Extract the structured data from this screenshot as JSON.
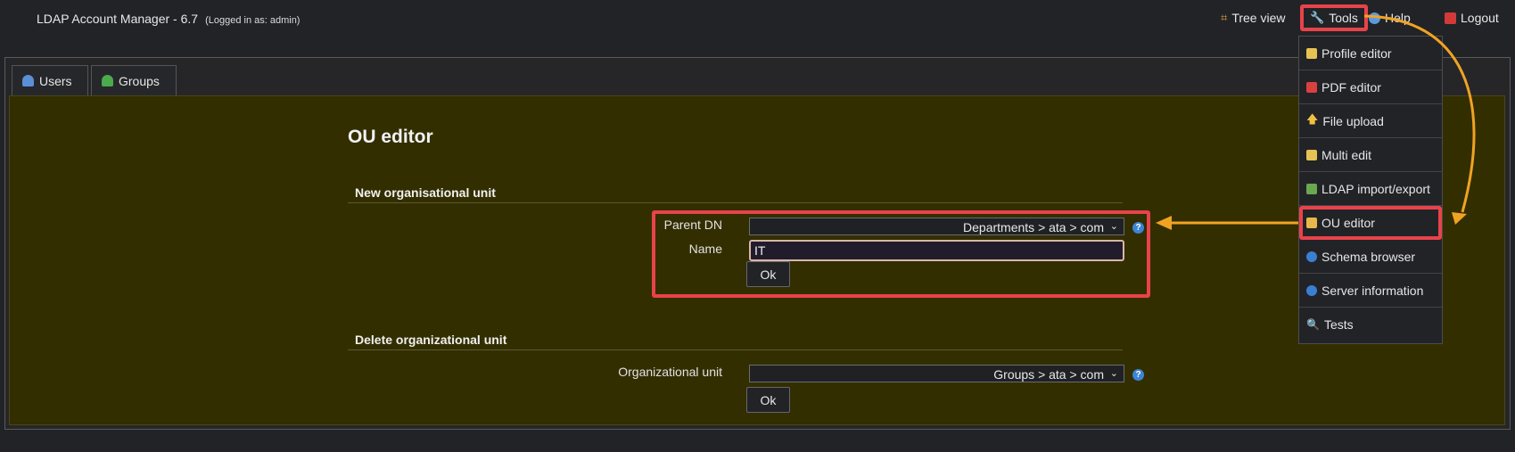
{
  "header": {
    "app_title": "LDAP Account Manager - 6.7",
    "logged_in": "(Logged in as: admin)",
    "links": {
      "tree_view": "Tree view",
      "tools": "Tools",
      "help": "Help",
      "logout": "Logout"
    }
  },
  "tabs": [
    {
      "label": "Users"
    },
    {
      "label": "Groups"
    }
  ],
  "page": {
    "title": "OU editor",
    "new_section": {
      "heading": "New organisational unit",
      "parent_dn_label": "Parent DN",
      "parent_dn_value": "Departments > ata > com",
      "name_label": "Name",
      "name_value": "IT",
      "ok_label": "Ok"
    },
    "delete_section": {
      "heading": "Delete organizational unit",
      "ou_label": "Organizational unit",
      "ou_value": "Groups > ata > com",
      "ok_label": "Ok"
    }
  },
  "tools_menu": {
    "items": [
      {
        "label": "Profile editor",
        "icon": "profile-edit-icon"
      },
      {
        "label": "PDF editor",
        "icon": "pdf-icon"
      },
      {
        "label": "File upload",
        "icon": "upload-arrow-icon"
      },
      {
        "label": "Multi edit",
        "icon": "multi-edit-icon"
      },
      {
        "label": "LDAP import/export",
        "icon": "import-export-icon"
      },
      {
        "label": "OU editor",
        "icon": "folder-icon",
        "selected": true
      },
      {
        "label": "Schema browser",
        "icon": "globe-icon"
      },
      {
        "label": "Server information",
        "icon": "info-icon"
      },
      {
        "label": "Tests",
        "icon": "magnifier-icon"
      }
    ]
  },
  "colors": {
    "highlight": "#e8434a",
    "annotation_arrow": "#f0a323",
    "content_bg": "#332e00"
  }
}
